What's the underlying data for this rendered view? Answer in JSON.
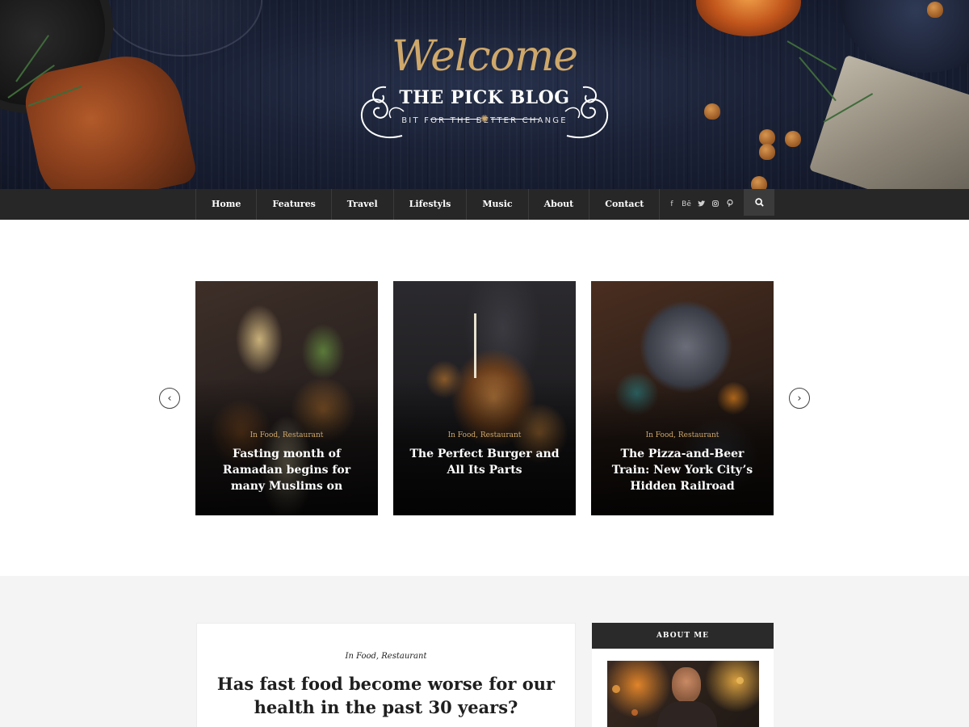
{
  "header": {
    "welcome": "Welcome",
    "blog_name": "THE PICK BLOG",
    "tagline": "BIT FOR THE BETTER CHANGE"
  },
  "nav": {
    "items": [
      "Home",
      "Features",
      "Travel",
      "Lifestyls",
      "Music",
      "About",
      "Contact"
    ],
    "social": [
      "f",
      "Bē",
      "twitter-icon",
      "instagram-icon",
      "pinterest-icon"
    ],
    "search_icon": "search-icon"
  },
  "carousel": {
    "prev_icon": "chevron-left-icon",
    "next_icon": "chevron-right-icon",
    "cards": [
      {
        "categories": "In Food, Restaurant",
        "title": "Fasting month of Ramadan begins for many Muslims on"
      },
      {
        "categories": "In Food, Restaurant",
        "title": "The Perfect Burger and All Its Parts"
      },
      {
        "categories": "In Food, Restaurant",
        "title": "The Pizza-and-Beer Train: New York City’s Hidden Railroad"
      }
    ]
  },
  "post": {
    "categories": "In Food, Restaurant",
    "title": "Has fast food become worse for our health in the past 30 years?"
  },
  "sidebar": {
    "about_title": "ABOUT ME"
  },
  "colors": {
    "accent_gold": "#cfa86a",
    "nav_bg": "#272727",
    "lower_bg": "#f4f4f4"
  }
}
